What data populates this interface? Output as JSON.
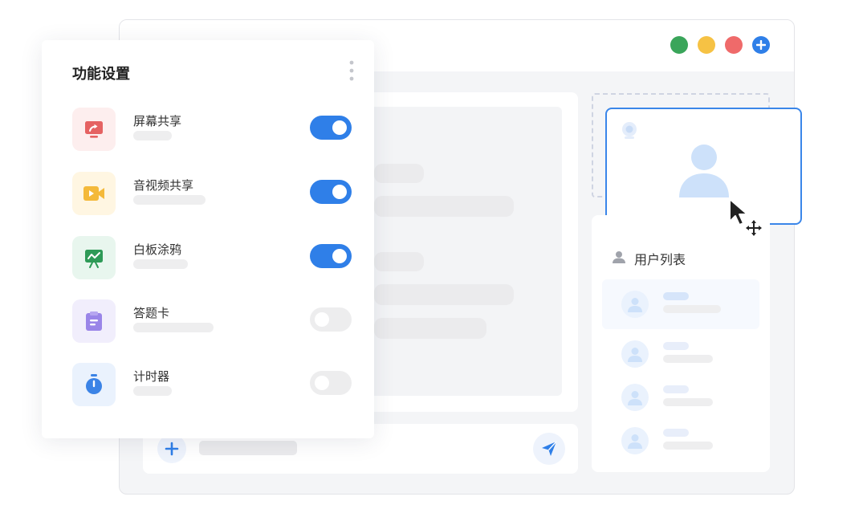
{
  "window": {
    "controls": [
      {
        "name": "green",
        "color": "#3aa55a"
      },
      {
        "name": "yellow",
        "color": "#f6c244"
      },
      {
        "name": "red",
        "color": "#ef6a6a"
      },
      {
        "name": "add",
        "color": "#2f7fe8",
        "icon": "plus-icon"
      }
    ]
  },
  "settings_panel": {
    "title": "功能设置",
    "more_icon": "more-vertical-icon",
    "features": [
      {
        "label": "屏幕共享",
        "icon": "screen-share-icon",
        "icon_bg": "#fdeeee",
        "icon_color": "#e56262",
        "enabled": true
      },
      {
        "label": "音视频共享",
        "icon": "video-camera-icon",
        "icon_bg": "#fff6e2",
        "icon_color": "#f4b93a",
        "enabled": true
      },
      {
        "label": "白板涂鸦",
        "icon": "whiteboard-icon",
        "icon_bg": "#e8f6ee",
        "icon_color": "#2e9a57",
        "enabled": true
      },
      {
        "label": "答题卡",
        "icon": "clipboard-icon",
        "icon_bg": "#f1eefc",
        "icon_color": "#9a85e8",
        "enabled": false
      },
      {
        "label": "计时器",
        "icon": "timer-icon",
        "icon_bg": "#eaf2fd",
        "icon_color": "#3b83e6",
        "enabled": false
      }
    ]
  },
  "user_list": {
    "title": "用户列表",
    "icon": "user-icon"
  },
  "colors": {
    "accent": "#2f7fe8",
    "toggle_off": "#ededee"
  }
}
